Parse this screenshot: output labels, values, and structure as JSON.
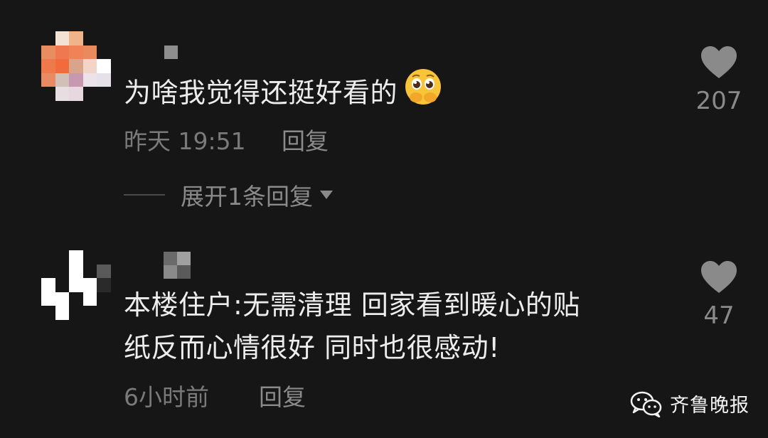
{
  "comments": [
    {
      "text": "为啥我觉得还挺好看的",
      "emoji": "pleading-face-emoji",
      "time": "昨天 19:51",
      "reply_label": "回复",
      "likes": "207",
      "expand_label": "展开1条回复"
    },
    {
      "text_line1": "本楼住户:无需清理 回家看到暖心的贴",
      "text_line2": "纸反而心情很好 同时也很感动!",
      "time": "6小时前",
      "reply_label": "回复",
      "likes": "47"
    }
  ],
  "watermark": {
    "text": "齐鲁晚报",
    "icon": "wechat-icon"
  },
  "colors": {
    "background": "#161616",
    "text_primary": "#ededed",
    "text_secondary": "#8a8a8a",
    "heart": "#8a8a8a"
  }
}
